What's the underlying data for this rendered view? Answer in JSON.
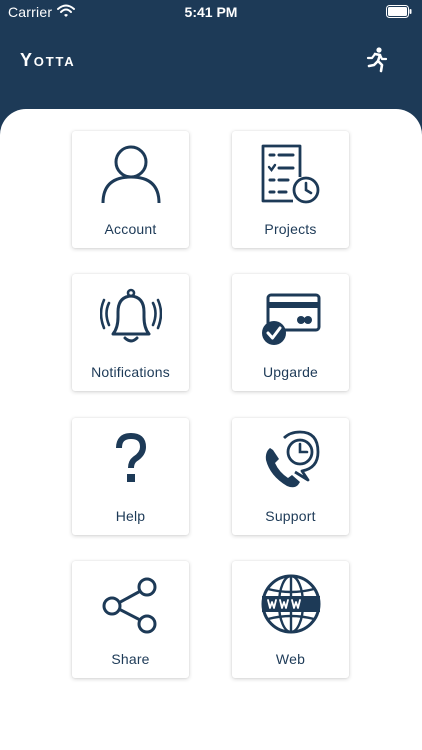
{
  "status_bar": {
    "carrier": "Carrier",
    "time": "5:41 PM",
    "wifi_icon": "wifi-icon",
    "battery_icon": "battery-icon"
  },
  "header": {
    "brand": "Yotta",
    "action_icon": "running-person-icon"
  },
  "colors": {
    "header_bg": "#1d3a57",
    "icon": "#1d3a57",
    "panel_bg": "#ffffff"
  },
  "tiles": [
    {
      "label": "Account",
      "icon": "user-icon"
    },
    {
      "label": "Projects",
      "icon": "project-checklist-clock-icon"
    },
    {
      "label": "Notifications",
      "icon": "bell-icon"
    },
    {
      "label": "Upgarde",
      "icon": "credit-card-check-icon"
    },
    {
      "label": "Help",
      "icon": "question-mark-icon"
    },
    {
      "label": "Support",
      "icon": "phone-clock-icon"
    },
    {
      "label": "Share",
      "icon": "share-icon"
    },
    {
      "label": "Web",
      "icon": "globe-www-icon"
    }
  ]
}
